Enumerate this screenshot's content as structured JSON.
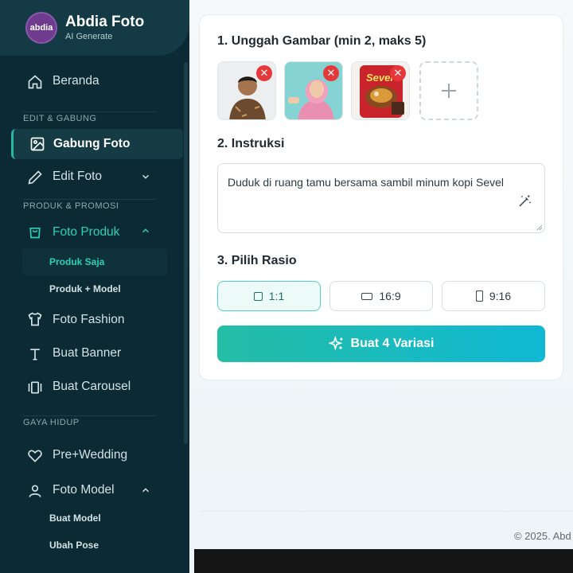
{
  "brand": {
    "logo_text": "abdia",
    "title": "Abdia Foto",
    "subtitle": "AI Generate"
  },
  "nav": {
    "home": "Beranda",
    "section_edit": "EDIT & GABUNG",
    "merge": "Gabung Foto",
    "edit": "Edit Foto",
    "section_product": "PRODUK & PROMOSI",
    "product": "Foto Produk",
    "product_only": "Produk Saja",
    "product_model": "Produk + Model",
    "fashion": "Foto Fashion",
    "banner": "Buat Banner",
    "carousel": "Buat Carousel",
    "section_life": "GAYA HIDUP",
    "prewedding": "Pre+Wedding",
    "model": "Foto Model",
    "make_model": "Buat Model",
    "change_pose": "Ubah Pose"
  },
  "form": {
    "step1": "1. Unggah Gambar (min 2, maks 5)",
    "step2": "2. Instruksi",
    "instruction": "Duduk di ruang tamu bersama sambil minum kopi Sevel",
    "step3": "3. Pilih Rasio",
    "ratios": [
      "1:1",
      "16:9",
      "9:16"
    ],
    "selected_ratio": "1:1",
    "product_label": "Sevel",
    "generate": "Buat 4 Variasi"
  },
  "footer": "© 2025. Abd",
  "colors": {
    "sidebar": "#0b2a33",
    "accent": "#26b8a6",
    "remove": "#e5383b"
  }
}
